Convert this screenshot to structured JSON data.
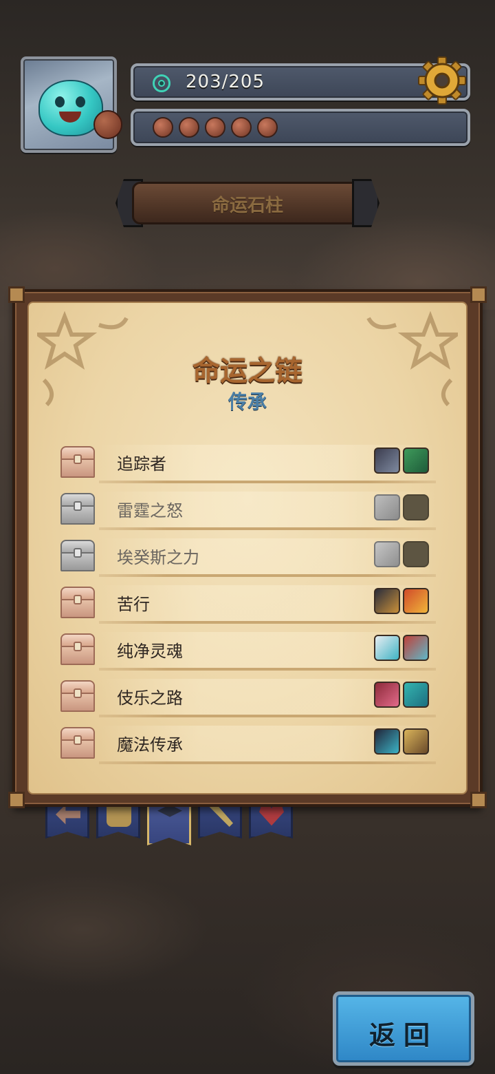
{
  "hud": {
    "energy": "203/205",
    "tokens_count": 5
  },
  "banner": {
    "title": "命运石柱"
  },
  "panel": {
    "title": "命运之链",
    "subtitle": "传承",
    "rows": [
      {
        "label": "追踪者",
        "unlocked": true,
        "heroes": [
          "pirate-hero",
          "goblin-hero"
        ]
      },
      {
        "label": "雷霆之怒",
        "unlocked": false,
        "heroes": [
          "armored-hero",
          "locked-silhouette"
        ]
      },
      {
        "label": "埃癸斯之力",
        "unlocked": false,
        "heroes": [
          "warrior-hero",
          "locked-silhouette"
        ]
      },
      {
        "label": "苦行",
        "unlocked": true,
        "heroes": [
          "monk-hero",
          "fire-hero"
        ]
      },
      {
        "label": "纯净灵魂",
        "unlocked": true,
        "heroes": [
          "ghost-hero",
          "axe-hero"
        ]
      },
      {
        "label": "伎乐之路",
        "unlocked": true,
        "heroes": [
          "bard-hero",
          "siren-hero"
        ]
      },
      {
        "label": "魔法传承",
        "unlocked": true,
        "heroes": [
          "witch-hero",
          "mage-hero"
        ]
      }
    ]
  },
  "tabs": [
    {
      "icon": "back-arrow-icon"
    },
    {
      "icon": "tankard-icon"
    },
    {
      "icon": "graduation-cap-icon",
      "active": true
    },
    {
      "icon": "crossed-swords-icon"
    },
    {
      "icon": "heart-arrow-icon"
    }
  ],
  "buttons": {
    "back_label": "返回"
  },
  "colors": {
    "parchment": "#ecd5a6",
    "title": "#a8662f",
    "subtitle": "#4b7fa7",
    "button": "#2e86c6"
  }
}
